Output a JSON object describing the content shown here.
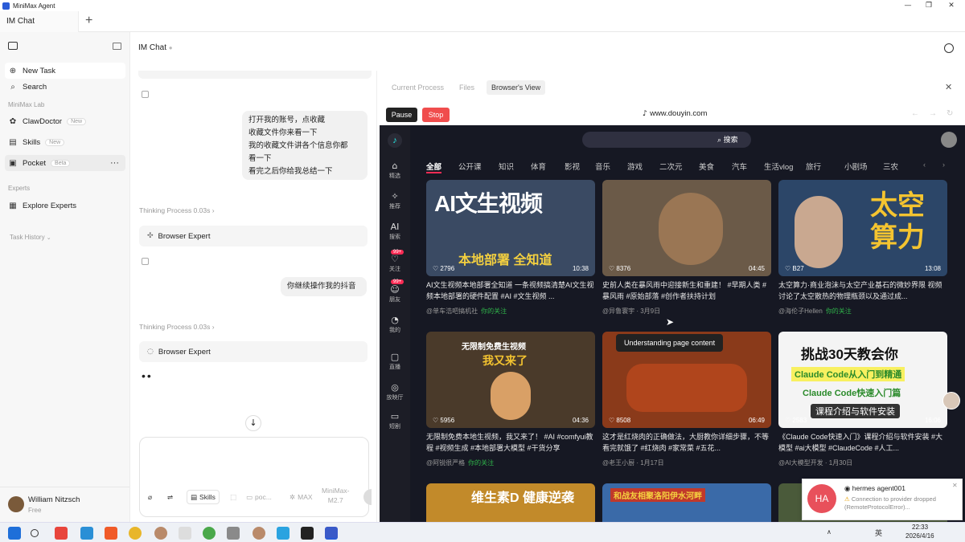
{
  "window": {
    "title": "MiniMax Agent",
    "minimize": "—",
    "maximize": "❐",
    "close": "✕"
  },
  "tabs": {
    "active": "IM Chat",
    "add": "+"
  },
  "sidebar": {
    "items": [
      {
        "label": "New Task",
        "icon": "plus-circle-icon",
        "glyph": "⊕"
      },
      {
        "label": "Search",
        "icon": "search-icon",
        "glyph": "⌕"
      },
      {
        "label": "ClawDoctor",
        "badge": "New",
        "icon": "stethoscope-icon",
        "glyph": "✿"
      },
      {
        "label": "Skills",
        "badge": "New",
        "icon": "skills-icon",
        "glyph": "▤"
      },
      {
        "label": "Pocket",
        "badge": "Beta",
        "icon": "pocket-icon",
        "glyph": "▣",
        "more": "···"
      },
      {
        "label": "Explore Experts",
        "icon": "experts-icon",
        "glyph": "▦"
      }
    ],
    "section_lab": "MiniMax Lab",
    "section_experts": "Experts",
    "section_history": "Task History",
    "user": {
      "name": "William Nitzsch",
      "plan": "Free"
    }
  },
  "chat": {
    "title": "IM Chat",
    "user_message_1": [
      "打开我的账号，点收藏",
      "收藏文件你来看一下",
      "我的收藏文件讲各个信息你都",
      "看一下",
      "看完之后你给我总结一下"
    ],
    "thinking_1": "Thinking Process 0.03s",
    "expert_1": "Browser Expert",
    "user_message_2": "你继续操作我的抖音",
    "thinking_2": "Thinking Process 0.03s",
    "expert_2": "Browser Expert",
    "input": {
      "skills": "Skills",
      "pocket": "poc...",
      "mode": "MAX",
      "model_line1": "MiniMax-",
      "model_line2": "M2.7"
    }
  },
  "panel": {
    "tabs": [
      "Current Process",
      "Files",
      "Browser's View"
    ],
    "pause": "Pause",
    "stop": "Stop",
    "url": "www.douyin.com",
    "close": "✕"
  },
  "douyin": {
    "search_btn": "搜索",
    "nav": [
      {
        "label": "精选",
        "glyph": "⌂"
      },
      {
        "label": "推荐",
        "glyph": "✧"
      },
      {
        "label": "搜索",
        "glyph": "AI"
      },
      {
        "label": "关注",
        "glyph": "♡",
        "badge": "99+"
      },
      {
        "label": "朋友",
        "glyph": "☺",
        "badge": "99+"
      },
      {
        "label": "我的",
        "glyph": "◔"
      },
      {
        "label": "直播",
        "glyph": "▢"
      },
      {
        "label": "放映厅",
        "glyph": "◎"
      },
      {
        "label": "短剧",
        "glyph": "▭"
      }
    ],
    "categories": [
      "全部",
      "公开课",
      "知识",
      "体育",
      "影视",
      "音乐",
      "游戏",
      "二次元",
      "美食",
      "汽车",
      "生活vlog",
      "旅行",
      "小剧场",
      "三农"
    ],
    "tooltip": "Understanding page content",
    "cards": [
      {
        "thumb": "AI文生视频",
        "thumb_sub": "本地部署 全知道",
        "likes": "2796",
        "duration": "10:38",
        "text": "AI文生视频本地部署全知道 一条视频搞清楚AI文生视频本地部署的硬件配置 #AI #文生视频 ...",
        "author": "@单车浩吧搞机社",
        "follow": "你的关注",
        "color": "#3a4a63"
      },
      {
        "thumb": "",
        "thumb_sub": "",
        "likes": "8376",
        "duration": "04:45",
        "text": "史前人类在暴风雨中迎接新生和重建！ #早期人类 #暴风雨 #原始部落 #创作者扶持计划",
        "author": "@异鲁寰宇",
        "follow": "3月9日",
        "color": "#6b5a48"
      },
      {
        "thumb": "太空 算力",
        "thumb_sub": "",
        "likes": "B27",
        "duration": "13:08",
        "text": "太空算力·商业泡沫与太空产业基石的微妙界限 视频讨论了太空散热的物理瓶颈以及通过成...",
        "author": "@海伦子Hellen",
        "follow": "你的关注",
        "color": "#2c4668"
      },
      {
        "thumb": "无限制免费生视频",
        "thumb_sub": "我又来了",
        "likes": "5956",
        "duration": "04:36",
        "text": "无限制免费本地生视频，我又来了！ #AI #comfyui教程 #视频生成 #本地部署大模型 #干货分享",
        "author": "@阿锐很严格",
        "follow": "你的关注",
        "color": "#4a3a2a"
      },
      {
        "thumb": "",
        "thumb_sub": "",
        "likes": "8508",
        "duration": "06:49",
        "text": "这才是红烧肉的正确做法，大厨教你详细步骤，不等看完就饿了 #红烧肉 #家常菜 #五花...",
        "author": "@老王小厨",
        "follow": "1月17日",
        "color": "#8a3a1a"
      },
      {
        "thumb": "挑战30天教会你",
        "thumb_sub": "Claude Code从入门到精通",
        "thumb_sub2": "Claude Code快速入门篇",
        "thumb_sub3": "课程介绍与软件安装",
        "likes": "2583",
        "duration": "16:06",
        "text": "《Claude Code快速入门》课程介绍与软件安装 #大模型 #ai大模型 #ClaudeCode #人工...",
        "author": "@AI大模型开发",
        "follow": "1月30日",
        "color": "#f4f4f4"
      }
    ],
    "bottom_thumbs": [
      "维生素D 健康逆袭",
      "和战友相聚洛阳伊水河畔",
      ""
    ]
  },
  "notification": {
    "avatar": "HA",
    "title": "hermes agent001",
    "body": "Connection to provider dropped (RemoteProtocolError)..."
  },
  "taskbar": {
    "time": "22:33",
    "date": "2026/4/16",
    "lang": "英"
  }
}
